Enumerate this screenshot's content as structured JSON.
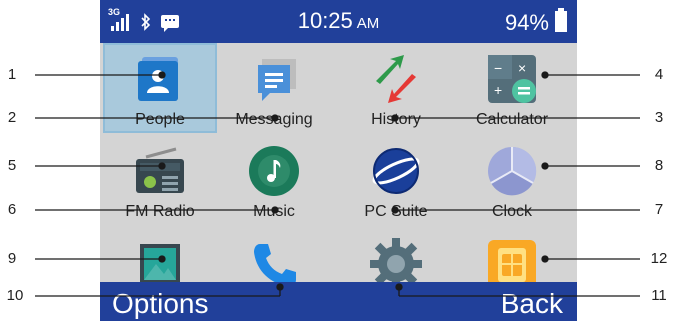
{
  "status_bar": {
    "network": "3G",
    "time": "10:25",
    "ampm": "AM",
    "battery": "94%"
  },
  "apps": [
    {
      "label": "People",
      "icon": "people-icon",
      "selected": true
    },
    {
      "label": "Messaging",
      "icon": "messaging-icon"
    },
    {
      "label": "History",
      "icon": "history-icon"
    },
    {
      "label": "Calculator",
      "icon": "calculator-icon"
    },
    {
      "label": "FM Radio",
      "icon": "radio-icon"
    },
    {
      "label": "Music",
      "icon": "music-icon"
    },
    {
      "label": "PC Suite",
      "icon": "pc-suite-icon"
    },
    {
      "label": "Clock",
      "icon": "clock-icon"
    },
    {
      "label": "",
      "icon": "gallery-icon"
    },
    {
      "label": "",
      "icon": "phone-icon"
    },
    {
      "label": "",
      "icon": "settings-icon"
    },
    {
      "label": "",
      "icon": "sim-icon"
    }
  ],
  "softkeys": {
    "left": "Options",
    "right": "Back"
  },
  "callouts": [
    "1",
    "2",
    "3",
    "4",
    "5",
    "6",
    "7",
    "8",
    "9",
    "10",
    "11",
    "12"
  ],
  "colors": {
    "bar": "#21409a",
    "screen": "#d4d4d4",
    "selection": "#a9c9dc"
  }
}
